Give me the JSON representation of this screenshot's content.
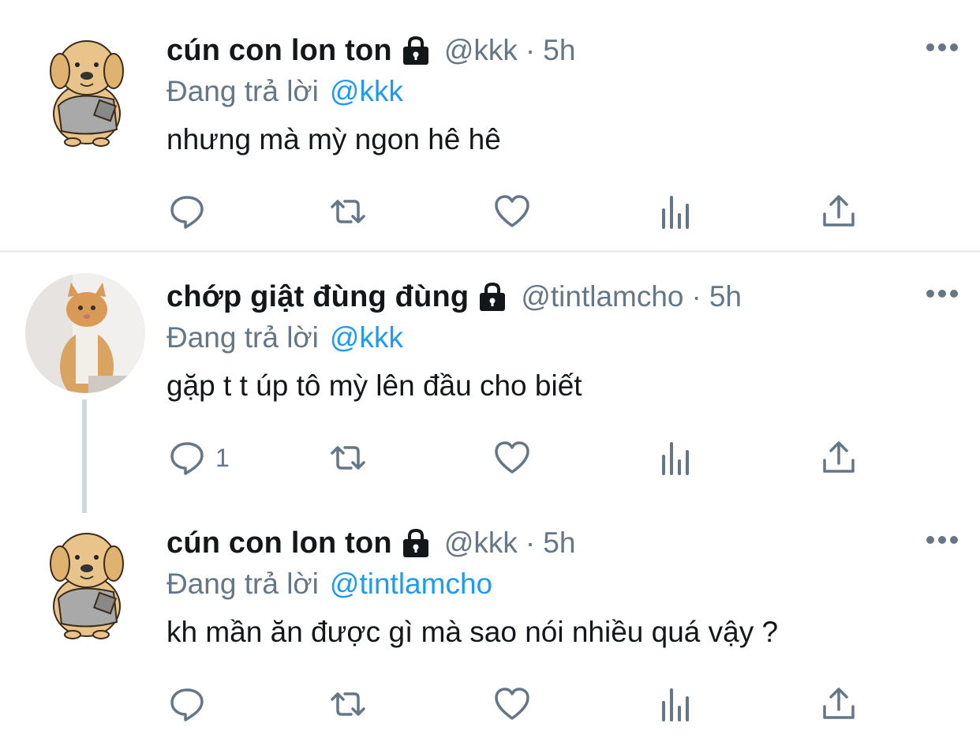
{
  "colors": {
    "link": "#1d9bf0",
    "muted": "#657786",
    "text": "#14171a",
    "divider": "#e6ecf0",
    "thread": "#cfd9de"
  },
  "icons": {
    "lock": "lock-icon",
    "more": "more-icon",
    "reply": "reply-icon",
    "retweet": "retweet-icon",
    "like": "like-icon",
    "analytics": "analytics-icon",
    "share": "share-icon"
  },
  "reply_prefix": "Đang trả lời",
  "tweets": [
    {
      "display_name": "cún con lon ton",
      "handle": "@kkk",
      "separator": "·",
      "time": "5h",
      "replying_to": "@kkk",
      "text": "nhưng mà mỳ ngon hê hê",
      "reply_count": ""
    },
    {
      "display_name": "chớp giật đùng đùng",
      "handle": "@tintlamcho",
      "separator": "·",
      "time": "5h",
      "replying_to": "@kkk",
      "text": "gặp t t úp tô mỳ lên đầu cho biết",
      "reply_count": "1"
    },
    {
      "display_name": "cún con lon ton",
      "handle": "@kkk",
      "separator": "·",
      "time": "5h",
      "replying_to": "@tintlamcho",
      "text": "kh mần ăn được gì mà sao nói nhiều quá vậy ?",
      "reply_count": ""
    }
  ]
}
